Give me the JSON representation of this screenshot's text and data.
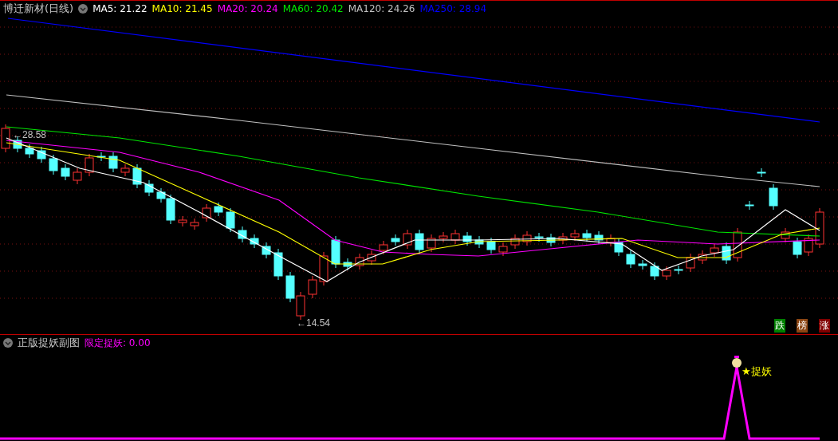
{
  "main_chart": {
    "title": "博迁新材(日线)",
    "indicators": [
      {
        "label": "MA5: 21.22",
        "color": "#ffffff"
      },
      {
        "label": "MA10: 21.45",
        "color": "#ffff00"
      },
      {
        "label": "MA20: 20.24",
        "color": "#ff00ff"
      },
      {
        "label": "MA60: 20.42",
        "color": "#00e600"
      },
      {
        "label": "MA120: 24.26",
        "color": "#c0c0c0"
      },
      {
        "label": "MA250: 28.94",
        "color": "#0000ff"
      }
    ],
    "high_label": "←28.58",
    "low_label": "←14.54",
    "badges": [
      {
        "text": "跌",
        "color": "#008000"
      },
      {
        "text": "榜",
        "color": "#8b4513"
      },
      {
        "text": "涨",
        "color": "#800000"
      }
    ]
  },
  "sub_chart": {
    "title": "正版捉妖副图",
    "indicator": "限定捉妖: 0.00",
    "signal": "★捉妖"
  }
}
